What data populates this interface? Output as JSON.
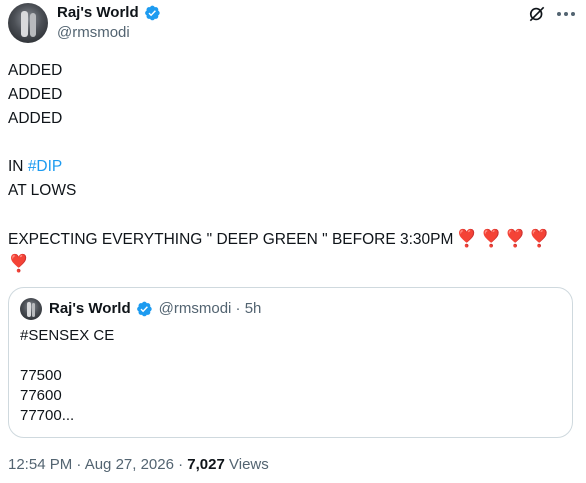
{
  "author": {
    "name": "Raj's World",
    "handle": "@rmsmodi"
  },
  "tweet": {
    "lines": [
      "ADDED",
      "ADDED",
      "ADDED",
      "",
      "IN "
    ],
    "hashtag": "#DIP",
    "line_after_hashtag": "AT LOWS",
    "expect_line": "EXPECTING EVERYTHING \" DEEP GREEN \" BEFORE 3:30PM",
    "heart_glyph": "❣️",
    "heart_count": 5
  },
  "quote": {
    "name": "Raj's World",
    "meta": "@rmsmodi · 5h",
    "lines": [
      "#SENSEX CE",
      "",
      "77500",
      "77600",
      "77700..."
    ]
  },
  "footer": {
    "time_date": "12:54 PM · Aug 27, 2026 · ",
    "views_count": "7,027",
    "views_label": " Views"
  },
  "colors": {
    "link": "#1d9bf0",
    "verified": "#1d9bf0",
    "heart": "#dd2e44",
    "secondary_text": "#536471"
  },
  "icons": [
    "verified-badge-icon",
    "grok-icon",
    "more-options-icon",
    "heart-exclamation-icon"
  ]
}
